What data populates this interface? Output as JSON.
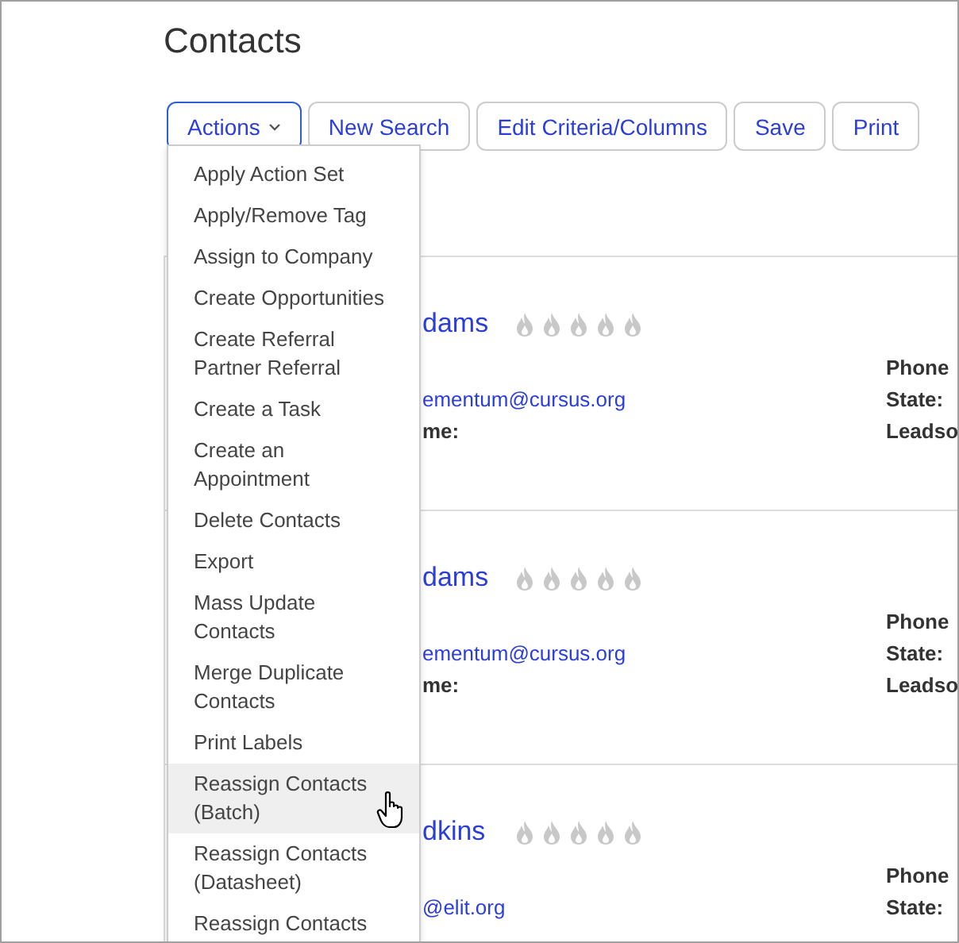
{
  "title": "Contacts",
  "toolbar": [
    {
      "label": "Actions",
      "kind": "dropdown",
      "expanded": true
    },
    {
      "label": "New Search",
      "kind": "button",
      "expanded": false
    },
    {
      "label": "Edit Criteria/Columns",
      "kind": "button",
      "expanded": false
    },
    {
      "label": "Save",
      "kind": "button",
      "expanded": false
    },
    {
      "label": "Print",
      "kind": "button",
      "expanded": false
    }
  ],
  "actions_menu": [
    {
      "label": "Apply Action Set",
      "highlighted": false
    },
    {
      "label": "Apply/Remove Tag",
      "highlighted": false
    },
    {
      "label": "Assign to Company",
      "highlighted": false
    },
    {
      "label": "Create Opportunities",
      "highlighted": false
    },
    {
      "label": "Create Referral Partner Referral",
      "highlighted": false
    },
    {
      "label": "Create a Task",
      "highlighted": false
    },
    {
      "label": "Create an Appointment",
      "highlighted": false
    },
    {
      "label": "Delete Contacts",
      "highlighted": false
    },
    {
      "label": "Export",
      "highlighted": false
    },
    {
      "label": "Mass Update Contacts",
      "highlighted": false
    },
    {
      "label": "Merge Duplicate Contacts",
      "highlighted": false
    },
    {
      "label": "Print Labels",
      "highlighted": false
    },
    {
      "label": "Reassign Contacts (Batch)",
      "highlighted": true
    },
    {
      "label": "Reassign Contacts (Datasheet)",
      "highlighted": false
    },
    {
      "label": "Reassign Contacts",
      "highlighted": false
    }
  ],
  "contacts": [
    {
      "name": "dams",
      "stars": 0,
      "email": "ementum@cursus.org",
      "field_label": "me:",
      "right_labels": [
        "Phone",
        "State:",
        "Leadso"
      ]
    },
    {
      "name": "dams",
      "stars": 0,
      "email": "ementum@cursus.org",
      "field_label": "me:",
      "right_labels": [
        "Phone",
        "State:",
        "Leadso"
      ]
    },
    {
      "name": "dkins",
      "stars": 0,
      "email": "@elit.org",
      "right_labels": [
        "Phone",
        "State:"
      ]
    }
  ]
}
